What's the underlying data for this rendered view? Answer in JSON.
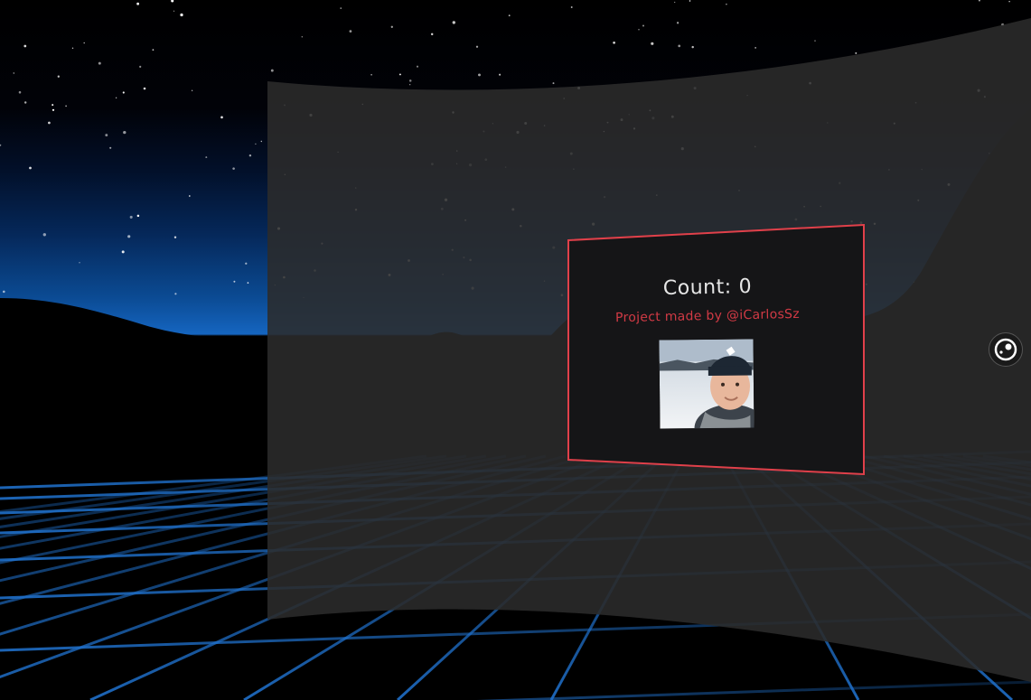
{
  "counter": {
    "label": "Count:",
    "value": "0"
  },
  "credit": {
    "text": "Project made by @iCarlosSz"
  },
  "avatar": {
    "icon": "profile-photo"
  },
  "vr_button": {
    "icon": "vr-headset-icon"
  },
  "colors": {
    "card_border": "#e0404a",
    "card_background": "#151517",
    "panel_background": "#2b2b2b",
    "grid_lines": "#1f6fc9",
    "credit_text": "#d23a45",
    "horizon_glow": "#1565c0"
  }
}
